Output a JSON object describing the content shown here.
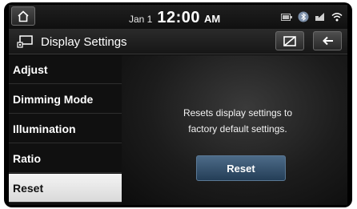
{
  "status_bar": {
    "date": "Jan 1",
    "time": "12:00",
    "ampm": "AM",
    "icons": [
      "home-icon",
      "phone-battery-icon",
      "bluetooth-icon",
      "cellular-signal-icon",
      "wifi-icon"
    ]
  },
  "header": {
    "title": "Display Settings",
    "icons": [
      "display-settings-icon",
      "screen-off-icon",
      "back-arrow-icon"
    ]
  },
  "sidebar": {
    "items": [
      {
        "label": "Adjust",
        "active": false
      },
      {
        "label": "Dimming Mode",
        "active": false
      },
      {
        "label": "Illumination",
        "active": false
      },
      {
        "label": "Ratio",
        "active": false
      },
      {
        "label": "Reset",
        "active": true
      }
    ]
  },
  "main": {
    "description_line1": "Resets display settings to",
    "description_line2": "factory default settings.",
    "reset_button_label": "Reset"
  },
  "colors": {
    "background": "#0a0a0a",
    "active_item": "#e6e6e6",
    "button_blue": "#3a5672",
    "text": "#ffffff"
  }
}
